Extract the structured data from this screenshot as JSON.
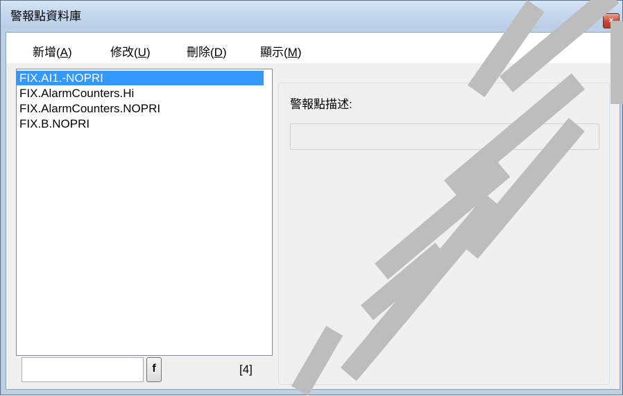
{
  "window": {
    "title": "警報點資料庫",
    "close_label": "×"
  },
  "menu": [
    {
      "label": "新增",
      "accel": "A"
    },
    {
      "label": "修改",
      "accel": "U"
    },
    {
      "label": "刪除",
      "accel": "D"
    },
    {
      "label": "顯示",
      "accel": "M"
    }
  ],
  "list": {
    "items": [
      "FIX.AI1.-NOPRI",
      "FIX.AlarmCounters.Hi",
      "FIX.AlarmCounters.NOPRI",
      "FIX.B.NOPRI"
    ],
    "selected_index": 0,
    "count_label": "[4]"
  },
  "filter": {
    "value": "",
    "button_label": "f"
  },
  "detail": {
    "desc_label": "警報點描述:",
    "desc_value": ""
  },
  "colors": {
    "selection": "#3399ff",
    "watermark": "#bdbdbd"
  }
}
